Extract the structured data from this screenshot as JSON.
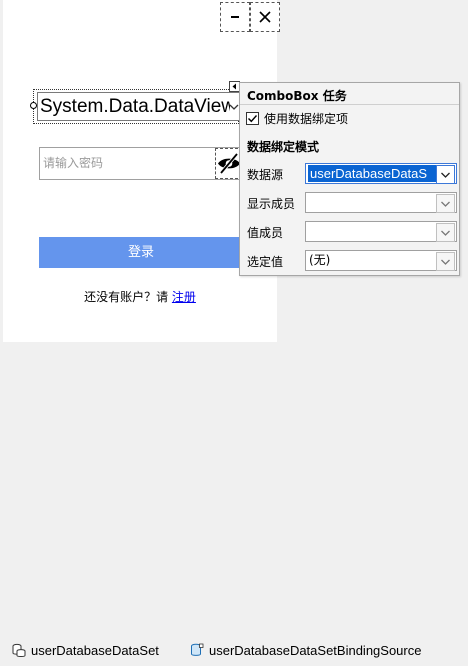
{
  "form": {
    "combo_text": "System.Data.DataView",
    "password_placeholder": "请输入密码",
    "login_label": "登录",
    "register_prompt": "还没有账户？请 ",
    "register_link": "注册"
  },
  "smart_tag_panel": {
    "title": "ComboBox 任务",
    "use_binding_label": "使用数据绑定项",
    "use_binding_checked": true,
    "section_title": "数据绑定模式",
    "rows": [
      {
        "label": "数据源",
        "value": "userDatabaseDataS"
      },
      {
        "label": "显示成员",
        "value": ""
      },
      {
        "label": "值成员",
        "value": ""
      },
      {
        "label": "选定值",
        "value": "(无)"
      }
    ]
  },
  "component_tray": {
    "items": [
      {
        "label": "userDatabaseDataSet"
      },
      {
        "label": "userDatabaseDataSetBindingSource"
      }
    ]
  },
  "colors": {
    "login_button": "#6495ed",
    "selection": "#0a64d2",
    "link": "#0000ee"
  }
}
